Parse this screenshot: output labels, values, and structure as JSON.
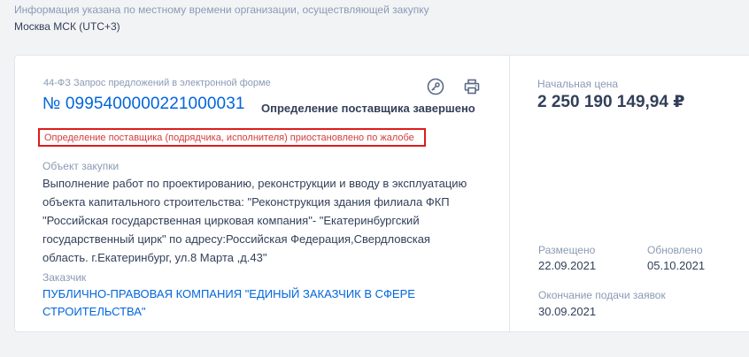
{
  "timezone": {
    "note": "Информация указана по местному времени организации, осуществляющей закупку",
    "value": "Москва МСК (UTC+3)"
  },
  "procurement": {
    "type": "44-ФЗ Запрос предложений в электронной форме",
    "number": "№ 0995400000221000031",
    "status": "Определение поставщика завершено",
    "alert": "Определение поставщика (подрядчика, исполнителя) приостановлено по жалобе",
    "object_label": "Объект закупки",
    "object_lines": [
      "Выполнение работ по проектированию, реконструкции и вводу в эксплуатацию",
      "объекта капитального строительства: \"Реконструкция здания филиала ФКП",
      "\"Российская государственная цирковая компания\"- \"Екатеринбургский",
      "государственный цирк\" по адресу:Российская Федерация,Свердловская",
      "область. г.Екатеринбург, ул.8 Марта ,д.43\""
    ],
    "customer_label": "Заказчик",
    "customer_lines": [
      "ПУБЛИЧНО-ПРАВОВАЯ КОМПАНИЯ \"ЕДИНЫЙ ЗАКАЗЧИК В СФЕРЕ",
      "СТРОИТЕЛЬСТВА\""
    ]
  },
  "pricing": {
    "label": "Начальная цена",
    "value": "2 250 190 149,94 ₽"
  },
  "dates": {
    "posted_label": "Размещено",
    "posted_value": "22.09.2021",
    "updated_label": "Обновлено",
    "updated_value": "05.10.2021",
    "deadline_label": "Окончание подачи заявок",
    "deadline_value": "30.09.2021"
  },
  "icons": {
    "key": "key-icon",
    "print": "printer-icon"
  },
  "colors": {
    "link": "#0065dd",
    "alert_border": "#e01b1b",
    "alert_text": "#d43c3c",
    "icon": "#5a6a85"
  }
}
